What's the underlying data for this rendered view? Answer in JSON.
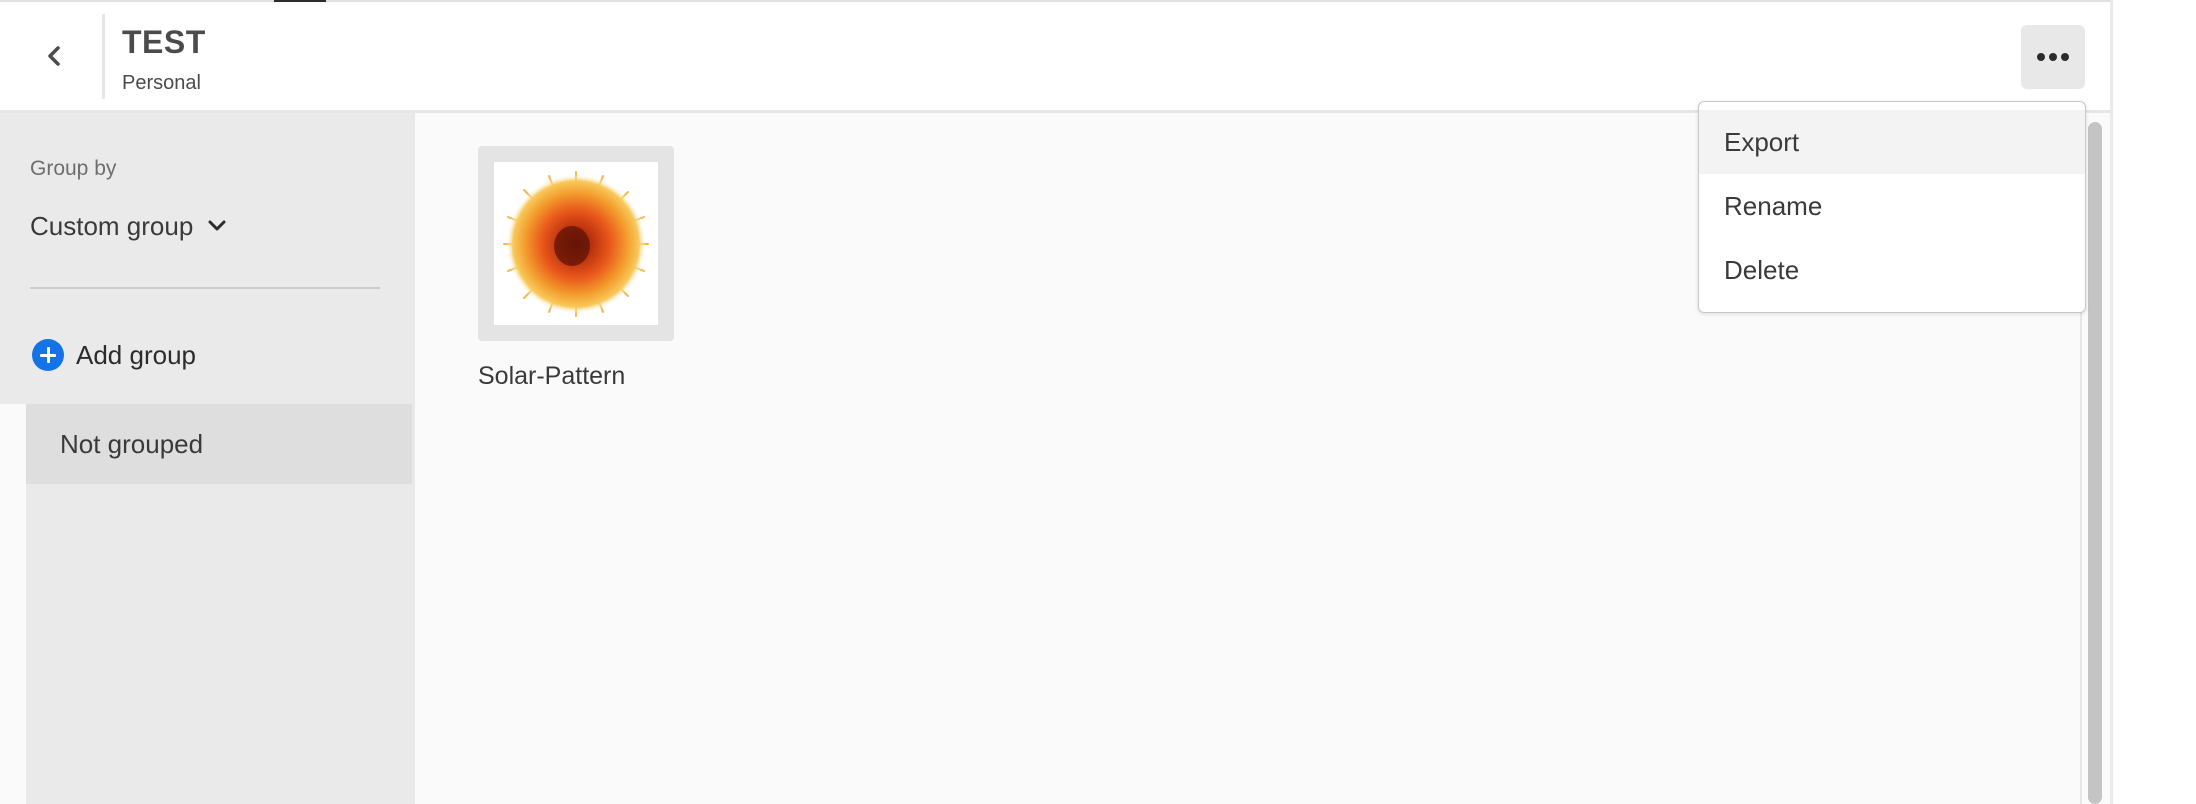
{
  "header": {
    "back_icon": "chevron-left-icon",
    "title": "TEST",
    "subtitle": "Personal",
    "more_icon": "more-horizontal-icon"
  },
  "sidebar": {
    "group_by_label": "Group by",
    "group_by_value": "Custom group",
    "add_group_label": "Add group",
    "groups": [
      {
        "label": "Not grouped",
        "selected": true
      }
    ]
  },
  "content": {
    "items": [
      {
        "name": "Solar-Pattern",
        "thumbnail": "solar-burst-image"
      }
    ]
  },
  "menu": {
    "items": [
      {
        "label": "Export",
        "hovered": true
      },
      {
        "label": "Rename"
      },
      {
        "label": "Delete"
      }
    ]
  },
  "colors": {
    "accent": "#1473e6",
    "sidebar_bg": "#eaeaea",
    "content_bg": "#fafafa",
    "text": "#2c2c2c"
  }
}
